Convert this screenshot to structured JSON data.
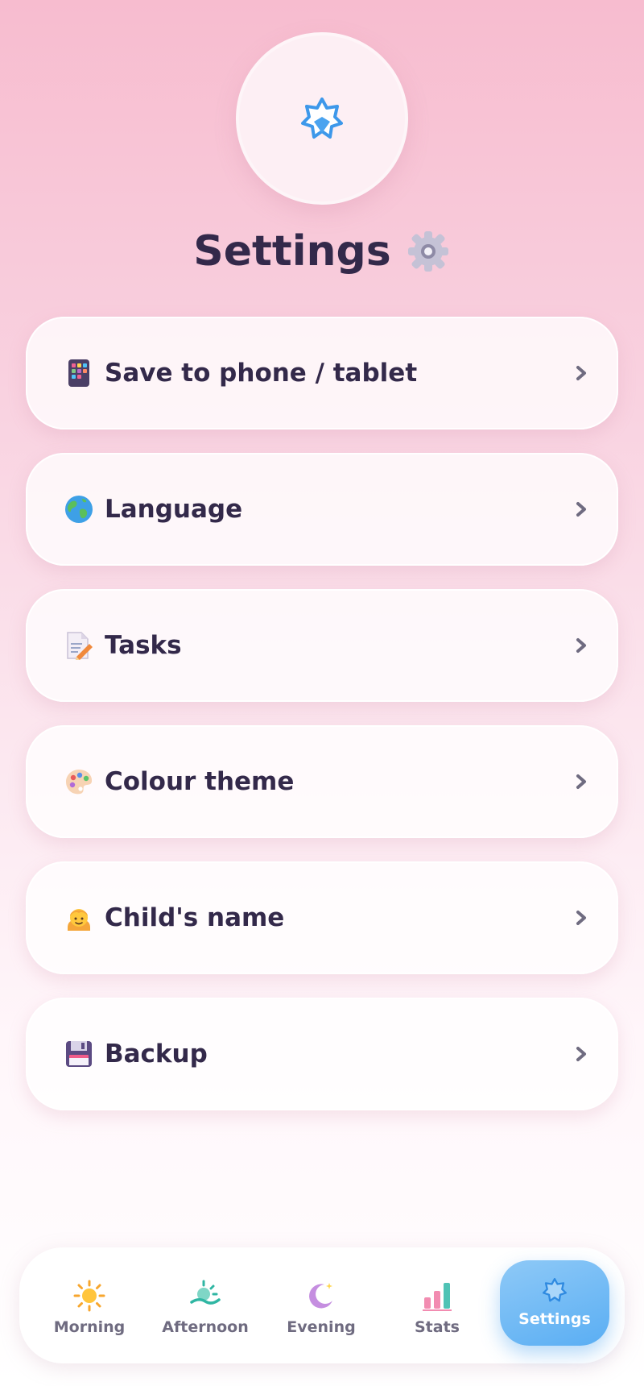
{
  "header": {
    "avatar_icon": "blue-star-icon",
    "title": "Settings",
    "title_icon": "gear-icon"
  },
  "menu": {
    "items": [
      {
        "label": "Save to phone / tablet",
        "icon": "phone-icon"
      },
      {
        "label": "Language",
        "icon": "globe-icon"
      },
      {
        "label": "Tasks",
        "icon": "memo-icon"
      },
      {
        "label": "Colour theme",
        "icon": "palette-icon"
      },
      {
        "label": "Child's name",
        "icon": "child-icon"
      },
      {
        "label": "Backup",
        "icon": "floppy-disk-icon"
      }
    ]
  },
  "tabs": {
    "items": [
      {
        "label": "Morning",
        "icon": "sun-icon"
      },
      {
        "label": "Afternoon",
        "icon": "sunset-icon"
      },
      {
        "label": "Evening",
        "icon": "moon-icon"
      },
      {
        "label": "Stats",
        "icon": "bar-chart-icon"
      },
      {
        "label": "Settings",
        "icon": "star-icon",
        "active": true
      }
    ]
  },
  "colors": {
    "text": "#33294a",
    "accent": "#5aaef3",
    "chevron": "#6f6b80"
  }
}
